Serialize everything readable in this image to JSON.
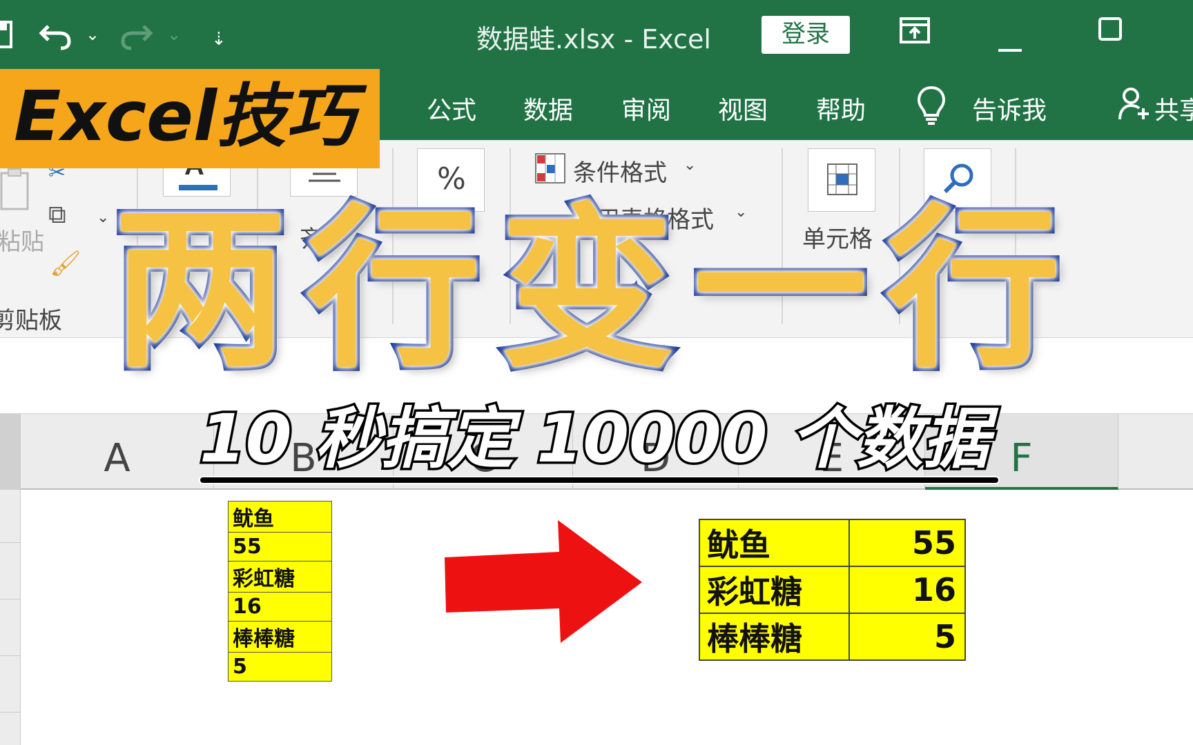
{
  "titlebar": {
    "title": "数据蛙.xlsx  -  Excel",
    "login_label": "登录",
    "icons": [
      "save-icon",
      "undo-icon",
      "redo-icon",
      "customize-quick-access-icon",
      "ribbon-display-options-icon",
      "minimize-icon",
      "maximize-icon"
    ]
  },
  "tabs": {
    "formulas": "公式",
    "data": "数据",
    "review": "审阅",
    "view": "视图",
    "help": "帮助",
    "tell_me": "告诉我",
    "share": "共享"
  },
  "ribbon": {
    "conditional_format": "条件格式",
    "table_format": "套用表格格式",
    "cells": "单元格",
    "clipboard": "剪贴板",
    "paste": "粘贴",
    "align": "齐",
    "percent": "%"
  },
  "columns": [
    "A",
    "B",
    "C",
    "D",
    "E",
    "F"
  ],
  "overlay": {
    "banner": "Excel技巧",
    "main_title": "两行变一行",
    "subtitle": "10 秒搞定 10000 个数据"
  },
  "source_list": [
    "鱿鱼",
    "55",
    "彩虹糖",
    "16",
    "棒棒糖",
    "5"
  ],
  "result_table": [
    {
      "name": "鱿鱼",
      "value": "55"
    },
    {
      "name": "彩虹糖",
      "value": "16"
    },
    {
      "name": "棒棒糖",
      "value": "5"
    }
  ],
  "colors": {
    "excel_green": "#217346",
    "banner_orange": "#f5a61b",
    "title_yellow": "#f6c244",
    "title_blue": "#1e3c9e",
    "cell_yellow": "#ffff00",
    "arrow_red": "#ee1111"
  }
}
